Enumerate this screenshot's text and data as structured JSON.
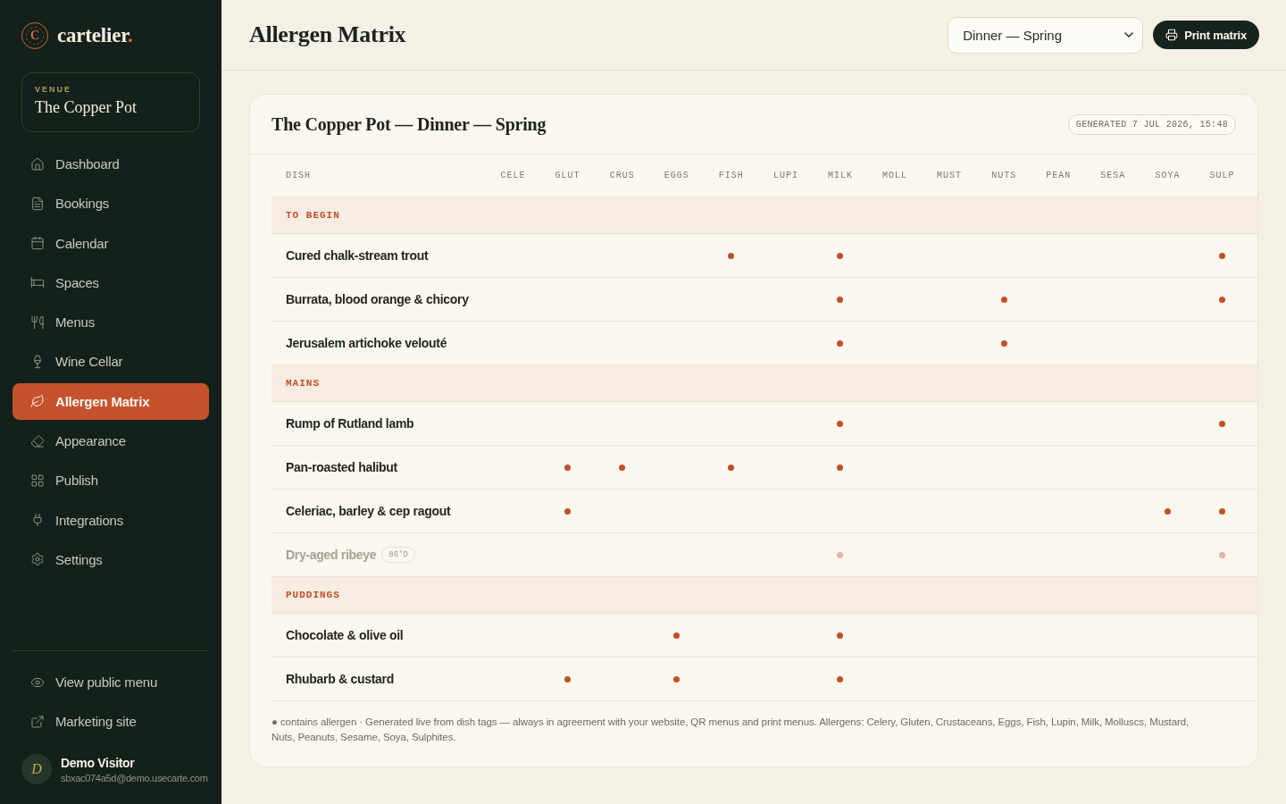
{
  "sidebar": {
    "brand": {
      "mark": "C",
      "name": "cartelier",
      "dot": "."
    },
    "venue": {
      "label": "VENUE",
      "name": "The Copper Pot"
    },
    "nav": [
      {
        "label": "Dashboard",
        "selected": false
      },
      {
        "label": "Bookings",
        "selected": false
      },
      {
        "label": "Calendar",
        "selected": false
      },
      {
        "label": "Spaces",
        "selected": false
      },
      {
        "label": "Menus",
        "selected": false
      },
      {
        "label": "Wine Cellar",
        "selected": false
      },
      {
        "label": "Allergen Matrix",
        "selected": true
      },
      {
        "label": "Appearance",
        "selected": false
      },
      {
        "label": "Publish",
        "selected": false
      },
      {
        "label": "Integrations",
        "selected": false
      },
      {
        "label": "Settings",
        "selected": false
      }
    ],
    "links": [
      {
        "label": "View public menu"
      },
      {
        "label": "Marketing site"
      }
    ],
    "user": {
      "initial": "D",
      "name": "Demo Visitor",
      "email": "sbxac074a5d@demo.usecarte.com"
    }
  },
  "header": {
    "title": "Allergen Matrix",
    "menu_select": {
      "value": "Dinner — Spring"
    },
    "print_button": "Print matrix"
  },
  "matrix": {
    "title": "The Copper Pot — Dinner — Spring",
    "generated": "GENERATED 7 JUL 2026, 15:48",
    "columns": [
      "DISH",
      "CELE",
      "GLUT",
      "CRUS",
      "EGGS",
      "FISH",
      "LUPI",
      "MILK",
      "MOLL",
      "MUST",
      "NUTS",
      "PEAN",
      "SESA",
      "SOYA",
      "SULP"
    ],
    "sections": [
      {
        "name": "TO BEGIN",
        "dishes": [
          {
            "name": "Cured chalk-stream trout",
            "unavailable": false,
            "allergens": [
              false,
              false,
              false,
              false,
              true,
              false,
              true,
              false,
              false,
              false,
              false,
              false,
              false,
              true
            ]
          },
          {
            "name": "Burrata, blood orange & chicory",
            "unavailable": false,
            "allergens": [
              false,
              false,
              false,
              false,
              false,
              false,
              true,
              false,
              false,
              true,
              false,
              false,
              false,
              true
            ]
          },
          {
            "name": "Jerusalem artichoke velouté",
            "unavailable": false,
            "allergens": [
              false,
              false,
              false,
              false,
              false,
              false,
              true,
              false,
              false,
              true,
              false,
              false,
              false,
              false
            ]
          }
        ]
      },
      {
        "name": "MAINS",
        "dishes": [
          {
            "name": "Rump of Rutland lamb",
            "unavailable": false,
            "allergens": [
              false,
              false,
              false,
              false,
              false,
              false,
              true,
              false,
              false,
              false,
              false,
              false,
              false,
              true
            ]
          },
          {
            "name": "Pan-roasted halibut",
            "unavailable": false,
            "allergens": [
              false,
              true,
              true,
              false,
              true,
              false,
              true,
              false,
              false,
              false,
              false,
              false,
              false,
              false
            ]
          },
          {
            "name": "Celeriac, barley & cep ragout",
            "unavailable": false,
            "allergens": [
              false,
              true,
              false,
              false,
              false,
              false,
              false,
              false,
              false,
              false,
              false,
              false,
              true,
              true
            ]
          },
          {
            "name": "Dry-aged ribeye",
            "badge": "86'D",
            "unavailable": true,
            "allergens": [
              false,
              false,
              false,
              false,
              false,
              false,
              true,
              false,
              false,
              false,
              false,
              false,
              false,
              true
            ]
          }
        ]
      },
      {
        "name": "PUDDINGS",
        "dishes": [
          {
            "name": "Chocolate & olive oil",
            "unavailable": false,
            "allergens": [
              false,
              false,
              false,
              true,
              false,
              false,
              true,
              false,
              false,
              false,
              false,
              false,
              false,
              false
            ]
          },
          {
            "name": "Rhubarb & custard",
            "unavailable": false,
            "allergens": [
              false,
              true,
              false,
              true,
              false,
              false,
              true,
              false,
              false,
              false,
              false,
              false,
              false,
              false
            ]
          }
        ]
      }
    ],
    "note": "● contains allergen · Generated live from dish tags — always in agreement with your website, QR menus and print menus. Allergens: Celery, Gluten, Crustaceans, Eggs, Fish, Lupin, Milk, Molluscs, Mustard, Nuts, Peanuts, Sesame, Soya, Sulphites."
  }
}
